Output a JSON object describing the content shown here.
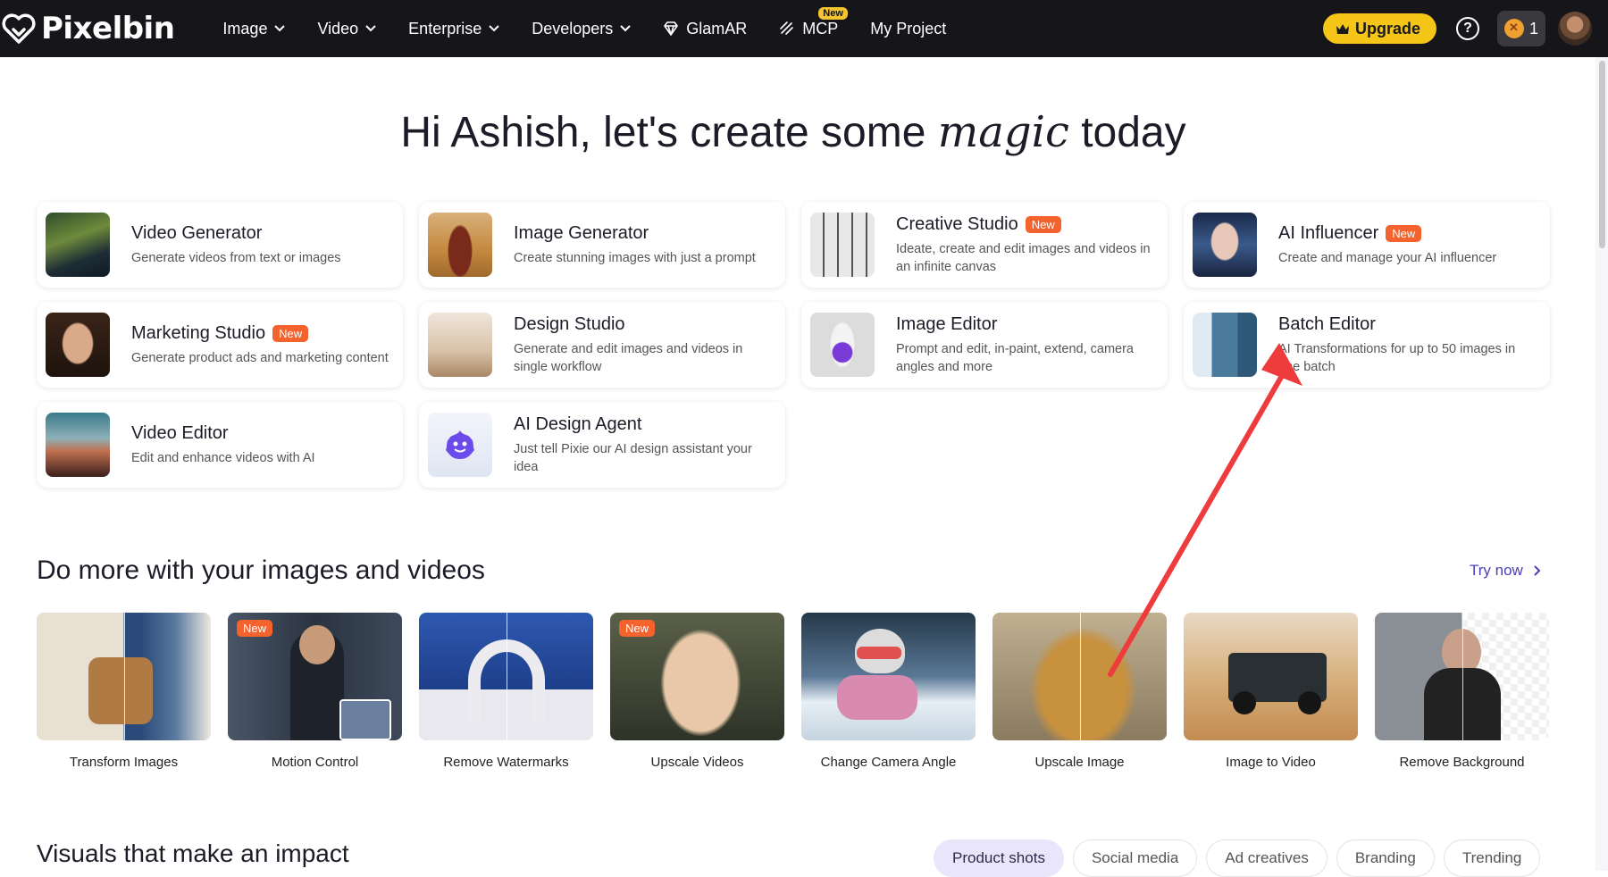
{
  "nav": {
    "logo_text": "Pixelbin",
    "menu": [
      {
        "label": "Image"
      },
      {
        "label": "Video"
      },
      {
        "label": "Enterprise"
      },
      {
        "label": "Developers"
      },
      {
        "label": "GlamAR"
      },
      {
        "label": "MCP",
        "badge": "New"
      },
      {
        "label": "My Project"
      }
    ],
    "upgrade": "Upgrade",
    "help": "?",
    "credits": "1"
  },
  "hero": {
    "prefix": "Hi Ashish, let's create some ",
    "magic": "magic",
    "suffix": " today"
  },
  "cards": [
    {
      "title": "Video Generator",
      "desc": "Generate videos from text or images",
      "new": ""
    },
    {
      "title": "Image Generator",
      "desc": "Create stunning images with just a prompt",
      "new": ""
    },
    {
      "title": "Creative Studio",
      "desc": "Ideate, create and edit images and videos in an infinite canvas",
      "new": "New"
    },
    {
      "title": "AI Influencer",
      "desc": "Create and manage your AI influencer",
      "new": "New"
    },
    {
      "title": "Marketing Studio",
      "desc": "Generate product ads and marketing content",
      "new": "New"
    },
    {
      "title": "Design Studio",
      "desc": "Generate and edit images and videos in single workflow",
      "new": ""
    },
    {
      "title": "Image Editor",
      "desc": "Prompt and edit, in-paint, extend, camera angles and more",
      "new": ""
    },
    {
      "title": "Batch Editor",
      "desc": "AI Transformations for up to 50 images in one batch",
      "new": ""
    },
    {
      "title": "Video Editor",
      "desc": "Edit and enhance videos with AI",
      "new": ""
    },
    {
      "title": "AI Design Agent",
      "desc": "Just tell Pixie our AI design assistant your idea",
      "new": ""
    }
  ],
  "more": {
    "title": "Do more with your images and videos",
    "try_now": "Try now",
    "tools": [
      {
        "label": "Transform Images",
        "new": ""
      },
      {
        "label": "Motion Control",
        "new": "New"
      },
      {
        "label": "Remove Watermarks",
        "new": ""
      },
      {
        "label": "Upscale Videos",
        "new": "New"
      },
      {
        "label": "Change Camera Angle",
        "new": ""
      },
      {
        "label": "Upscale Image",
        "new": ""
      },
      {
        "label": "Image to Video",
        "new": ""
      },
      {
        "label": "Remove Background",
        "new": ""
      }
    ]
  },
  "visuals": {
    "title": "Visuals that make an impact",
    "tabs": [
      "Product shots",
      "Social media",
      "Ad creatives",
      "Branding",
      "Trending"
    ]
  },
  "colors": {
    "nav_bg": "#16161a",
    "upgrade": "#f5c518",
    "new_badge": "#f4622e",
    "accent": "#4b3fb8",
    "arrow": "#ee3b3b"
  }
}
